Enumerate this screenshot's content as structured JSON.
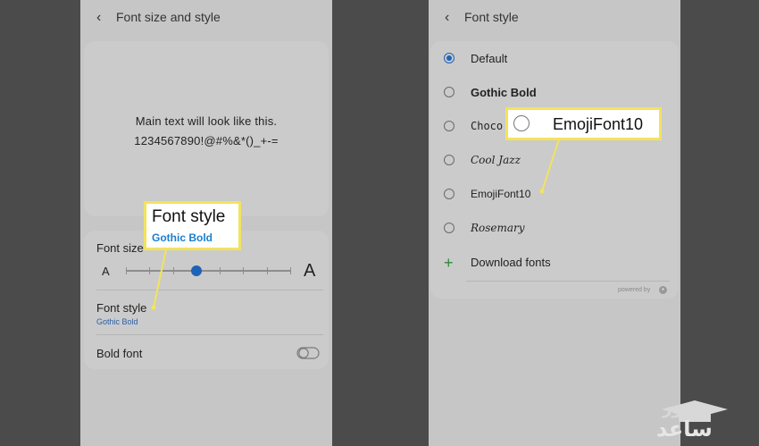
{
  "left_screen": {
    "header": {
      "title": "Font size and style"
    },
    "preview": {
      "line1": "Main text will look like this.",
      "line2": "1234567890!@#%&*()_+-="
    },
    "font_size": {
      "label": "Font size",
      "small_a": "A",
      "large_a": "A",
      "level": 0.43
    },
    "font_style": {
      "label": "Font style",
      "value": "Gothic Bold"
    },
    "bold_font": {
      "label": "Bold font",
      "enabled": false
    }
  },
  "right_screen": {
    "header": {
      "title": "Font style"
    },
    "fonts": [
      {
        "label": "Default",
        "selected": true
      },
      {
        "label": "Gothic Bold",
        "selected": false
      },
      {
        "label": "Choco",
        "selected": false
      },
      {
        "label": "Cool Jazz",
        "selected": false
      },
      {
        "label": "EmojiFont10",
        "selected": false
      },
      {
        "label": "Rosemary",
        "selected": false
      }
    ],
    "download": {
      "label": "Download fonts"
    },
    "powered_by": "powered by"
  },
  "callouts": {
    "font_style_title": "Font style",
    "font_style_sub": "Gothic Bold",
    "emoji_label": "EmojiFont10"
  },
  "watermark": {
    "line1": "نیوز",
    "line2": "ساعد"
  },
  "colors": {
    "accent": "#1e63b8",
    "callout_border": "#f2e35e",
    "callout_sub": "#1a7fcf",
    "download_plus": "#2e8b3d"
  }
}
